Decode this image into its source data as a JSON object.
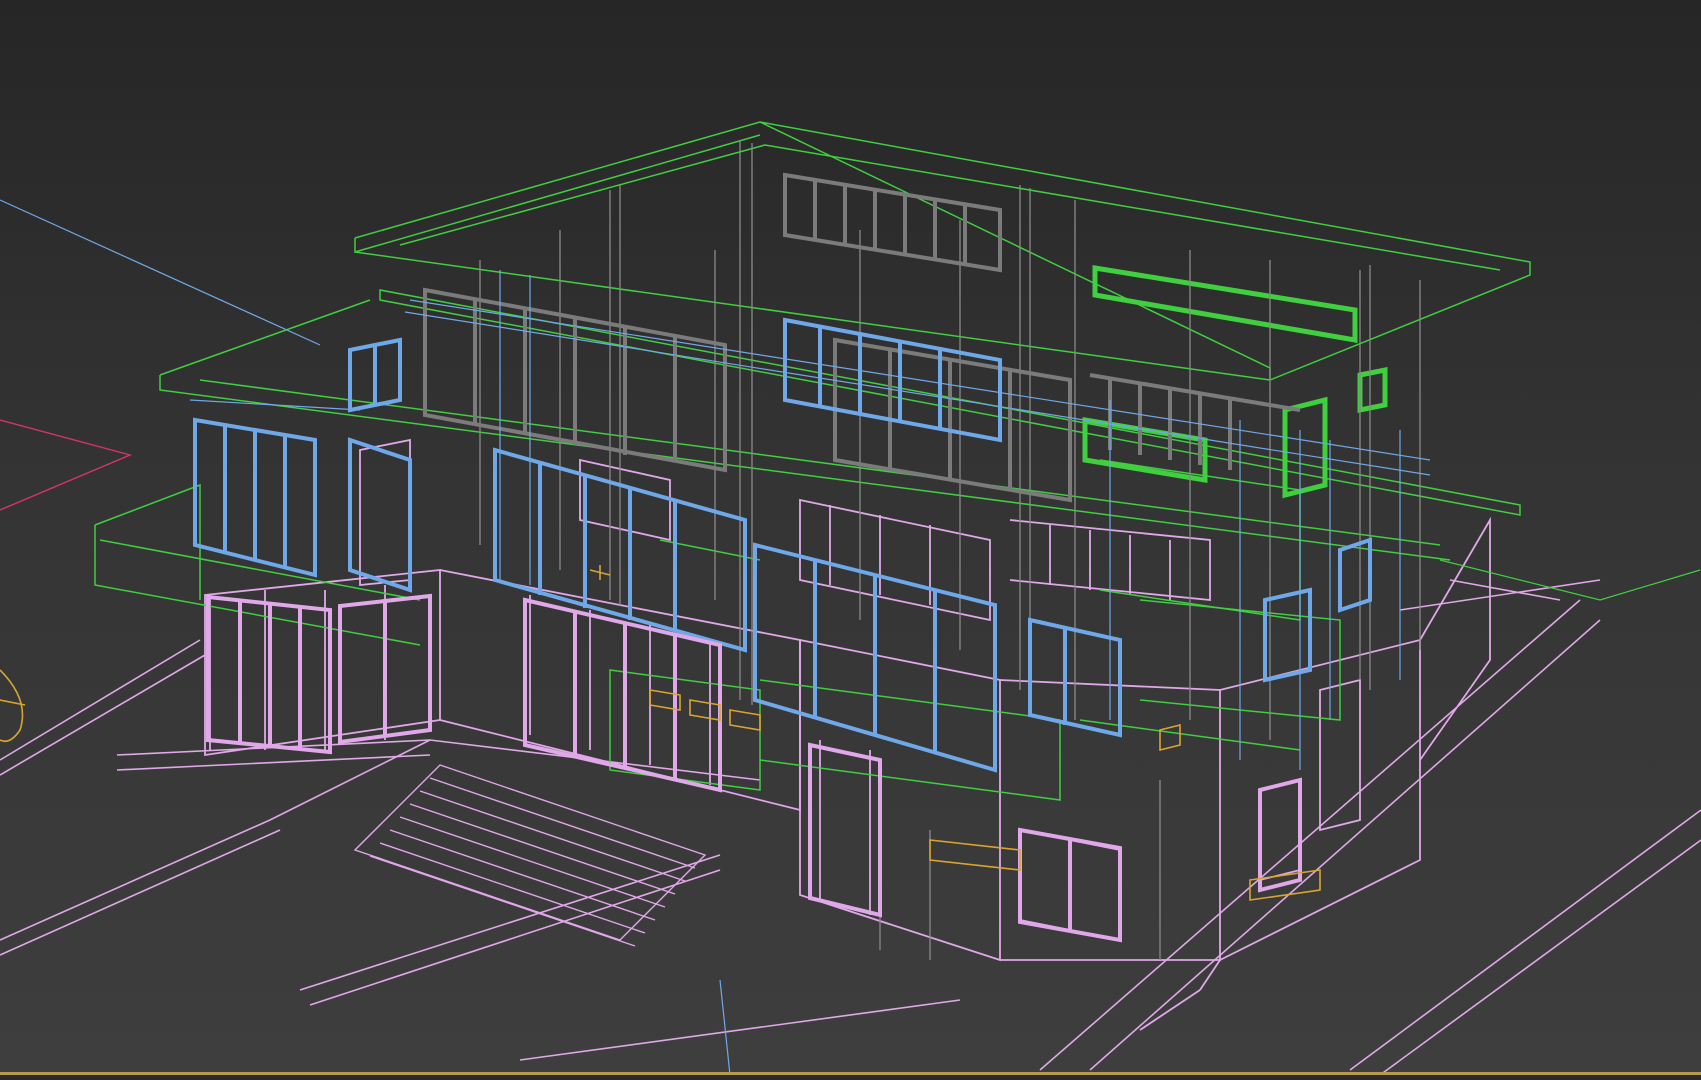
{
  "app": {
    "view": "perspective-wireframe-viewport"
  },
  "colors": {
    "background_top": "#262626",
    "background_bottom": "#3e3e3e",
    "ground_lines": "#e0a8e8",
    "slabs": "#3fcf3f",
    "glazing": "#6fa8e8",
    "structure": "#8a8a8a",
    "fixtures": "#d9a531",
    "axis_x": "#d8336a",
    "axis_y": "#6fa8e8",
    "selection_border": "#b89a4a"
  },
  "icons": {
    "light": "omni-light-icon",
    "camera": "camera-icon"
  }
}
